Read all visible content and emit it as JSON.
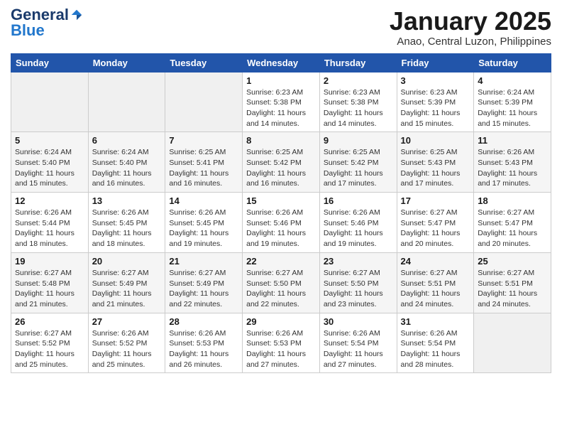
{
  "header": {
    "logo_general": "General",
    "logo_blue": "Blue",
    "title": "January 2025",
    "subtitle": "Anao, Central Luzon, Philippines"
  },
  "weekdays": [
    "Sunday",
    "Monday",
    "Tuesday",
    "Wednesday",
    "Thursday",
    "Friday",
    "Saturday"
  ],
  "weeks": [
    [
      {
        "day": "",
        "empty": true
      },
      {
        "day": "",
        "empty": true
      },
      {
        "day": "",
        "empty": true
      },
      {
        "day": "1",
        "sunrise": "6:23 AM",
        "sunset": "5:38 PM",
        "daylight": "11 hours and 14 minutes."
      },
      {
        "day": "2",
        "sunrise": "6:23 AM",
        "sunset": "5:38 PM",
        "daylight": "11 hours and 14 minutes."
      },
      {
        "day": "3",
        "sunrise": "6:23 AM",
        "sunset": "5:39 PM",
        "daylight": "11 hours and 15 minutes."
      },
      {
        "day": "4",
        "sunrise": "6:24 AM",
        "sunset": "5:39 PM",
        "daylight": "11 hours and 15 minutes."
      }
    ],
    [
      {
        "day": "5",
        "sunrise": "6:24 AM",
        "sunset": "5:40 PM",
        "daylight": "11 hours and 15 minutes."
      },
      {
        "day": "6",
        "sunrise": "6:24 AM",
        "sunset": "5:40 PM",
        "daylight": "11 hours and 16 minutes."
      },
      {
        "day": "7",
        "sunrise": "6:25 AM",
        "sunset": "5:41 PM",
        "daylight": "11 hours and 16 minutes."
      },
      {
        "day": "8",
        "sunrise": "6:25 AM",
        "sunset": "5:42 PM",
        "daylight": "11 hours and 16 minutes."
      },
      {
        "day": "9",
        "sunrise": "6:25 AM",
        "sunset": "5:42 PM",
        "daylight": "11 hours and 17 minutes."
      },
      {
        "day": "10",
        "sunrise": "6:25 AM",
        "sunset": "5:43 PM",
        "daylight": "11 hours and 17 minutes."
      },
      {
        "day": "11",
        "sunrise": "6:26 AM",
        "sunset": "5:43 PM",
        "daylight": "11 hours and 17 minutes."
      }
    ],
    [
      {
        "day": "12",
        "sunrise": "6:26 AM",
        "sunset": "5:44 PM",
        "daylight": "11 hours and 18 minutes."
      },
      {
        "day": "13",
        "sunrise": "6:26 AM",
        "sunset": "5:45 PM",
        "daylight": "11 hours and 18 minutes."
      },
      {
        "day": "14",
        "sunrise": "6:26 AM",
        "sunset": "5:45 PM",
        "daylight": "11 hours and 19 minutes."
      },
      {
        "day": "15",
        "sunrise": "6:26 AM",
        "sunset": "5:46 PM",
        "daylight": "11 hours and 19 minutes."
      },
      {
        "day": "16",
        "sunrise": "6:26 AM",
        "sunset": "5:46 PM",
        "daylight": "11 hours and 19 minutes."
      },
      {
        "day": "17",
        "sunrise": "6:27 AM",
        "sunset": "5:47 PM",
        "daylight": "11 hours and 20 minutes."
      },
      {
        "day": "18",
        "sunrise": "6:27 AM",
        "sunset": "5:47 PM",
        "daylight": "11 hours and 20 minutes."
      }
    ],
    [
      {
        "day": "19",
        "sunrise": "6:27 AM",
        "sunset": "5:48 PM",
        "daylight": "11 hours and 21 minutes."
      },
      {
        "day": "20",
        "sunrise": "6:27 AM",
        "sunset": "5:49 PM",
        "daylight": "11 hours and 21 minutes."
      },
      {
        "day": "21",
        "sunrise": "6:27 AM",
        "sunset": "5:49 PM",
        "daylight": "11 hours and 22 minutes."
      },
      {
        "day": "22",
        "sunrise": "6:27 AM",
        "sunset": "5:50 PM",
        "daylight": "11 hours and 22 minutes."
      },
      {
        "day": "23",
        "sunrise": "6:27 AM",
        "sunset": "5:50 PM",
        "daylight": "11 hours and 23 minutes."
      },
      {
        "day": "24",
        "sunrise": "6:27 AM",
        "sunset": "5:51 PM",
        "daylight": "11 hours and 24 minutes."
      },
      {
        "day": "25",
        "sunrise": "6:27 AM",
        "sunset": "5:51 PM",
        "daylight": "11 hours and 24 minutes."
      }
    ],
    [
      {
        "day": "26",
        "sunrise": "6:27 AM",
        "sunset": "5:52 PM",
        "daylight": "11 hours and 25 minutes."
      },
      {
        "day": "27",
        "sunrise": "6:26 AM",
        "sunset": "5:52 PM",
        "daylight": "11 hours and 25 minutes."
      },
      {
        "day": "28",
        "sunrise": "6:26 AM",
        "sunset": "5:53 PM",
        "daylight": "11 hours and 26 minutes."
      },
      {
        "day": "29",
        "sunrise": "6:26 AM",
        "sunset": "5:53 PM",
        "daylight": "11 hours and 27 minutes."
      },
      {
        "day": "30",
        "sunrise": "6:26 AM",
        "sunset": "5:54 PM",
        "daylight": "11 hours and 27 minutes."
      },
      {
        "day": "31",
        "sunrise": "6:26 AM",
        "sunset": "5:54 PM",
        "daylight": "11 hours and 28 minutes."
      },
      {
        "day": "",
        "empty": true
      }
    ]
  ],
  "labels": {
    "sunrise": "Sunrise:",
    "sunset": "Sunset:",
    "daylight": "Daylight:"
  }
}
